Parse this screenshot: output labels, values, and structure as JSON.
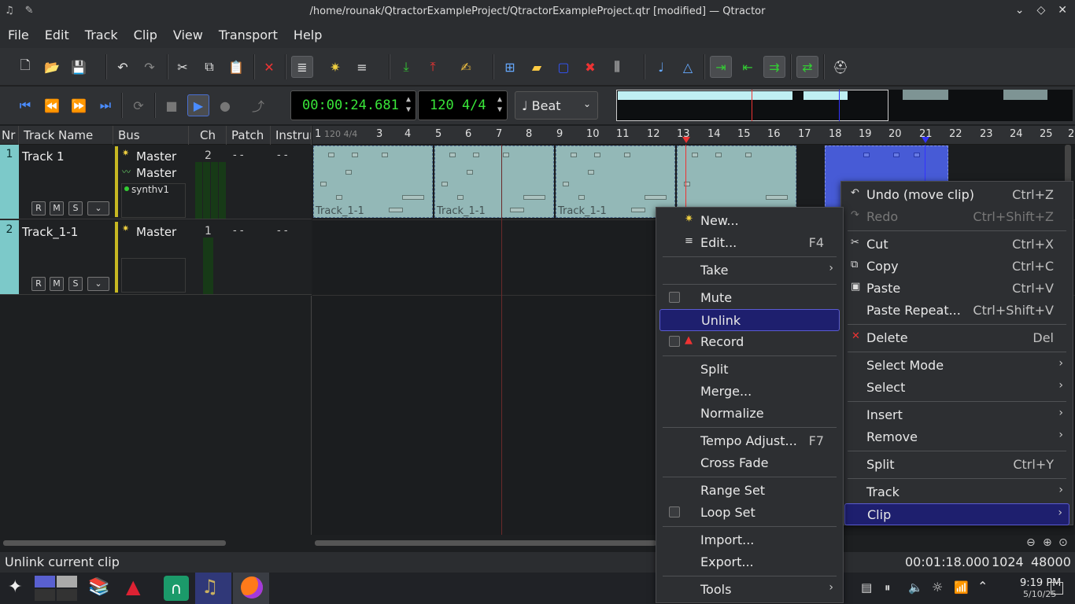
{
  "window": {
    "title": "/home/rounak/QtractorExampleProject/QtractorExampleProject.qtr [modified] — Qtractor"
  },
  "menubar": [
    "File",
    "Edit",
    "Track",
    "Clip",
    "View",
    "Transport",
    "Help"
  ],
  "transport": {
    "time": "00:00:24.681",
    "tempo": "120 4/4",
    "snap": "♩ Beat"
  },
  "track_header": {
    "col_num": "Nr",
    "col_name": "Track Name",
    "col_bus": "Bus",
    "col_ch": "Ch",
    "col_patch": "Patch",
    "col_instr": "Instrument"
  },
  "tracks": [
    {
      "num": "1",
      "name": "Track 1",
      "bus_in": "Master",
      "bus_out": "Master",
      "plugin": "synthv1",
      "ch": "2",
      "patch": "- -",
      "instr": "- -"
    },
    {
      "num": "2",
      "name": "Track_1-1",
      "bus_in": "Master",
      "ch": "1",
      "patch": "- -",
      "instr": "- -"
    }
  ],
  "rms_labels": {
    "r": "R",
    "m": "M",
    "s": "S"
  },
  "ruler": {
    "first": "1",
    "first_sig": "120 4/4",
    "bars": [
      "3",
      "4",
      "5",
      "6",
      "7",
      "8",
      "9",
      "10",
      "11",
      "12",
      "13",
      "14",
      "15",
      "16",
      "17",
      "18",
      "19",
      "20",
      "21",
      "22",
      "23",
      "24",
      "25",
      "2"
    ]
  },
  "clips": {
    "label": "Track_1-1"
  },
  "context_menu_clip": {
    "items": [
      {
        "label": "New...",
        "shortcut": ""
      },
      {
        "label": "Edit...",
        "shortcut": "F4"
      },
      {
        "label": "Take",
        "shortcut": ""
      },
      {
        "label": "Mute",
        "shortcut": ""
      },
      {
        "label": "Unlink",
        "shortcut": ""
      },
      {
        "label": "Record",
        "shortcut": ""
      },
      {
        "label": "Split",
        "shortcut": ""
      },
      {
        "label": "Merge...",
        "shortcut": ""
      },
      {
        "label": "Normalize",
        "shortcut": ""
      },
      {
        "label": "Tempo Adjust...",
        "shortcut": "F7"
      },
      {
        "label": "Cross Fade",
        "shortcut": ""
      },
      {
        "label": "Range Set",
        "shortcut": ""
      },
      {
        "label": "Loop Set",
        "shortcut": ""
      },
      {
        "label": "Import...",
        "shortcut": ""
      },
      {
        "label": "Export...",
        "shortcut": ""
      },
      {
        "label": "Tools",
        "shortcut": ""
      }
    ]
  },
  "context_menu_main": {
    "items": [
      {
        "label": "Undo (move clip)",
        "shortcut": "Ctrl+Z"
      },
      {
        "label": "Redo",
        "shortcut": "Ctrl+Shift+Z"
      },
      {
        "label": "Cut",
        "shortcut": "Ctrl+X"
      },
      {
        "label": "Copy",
        "shortcut": "Ctrl+C"
      },
      {
        "label": "Paste",
        "shortcut": "Ctrl+V"
      },
      {
        "label": "Paste Repeat...",
        "shortcut": "Ctrl+Shift+V"
      },
      {
        "label": "Delete",
        "shortcut": "Del"
      },
      {
        "label": "Select Mode",
        "shortcut": ""
      },
      {
        "label": "Select",
        "shortcut": ""
      },
      {
        "label": "Insert",
        "shortcut": ""
      },
      {
        "label": "Remove",
        "shortcut": ""
      },
      {
        "label": "Split",
        "shortcut": "Ctrl+Y"
      },
      {
        "label": "Track",
        "shortcut": ""
      },
      {
        "label": "Clip",
        "shortcut": ""
      }
    ]
  },
  "status": {
    "message": "Unlink current clip",
    "length": "00:01:18.000",
    "buffer": "1024",
    "rate": "48000"
  },
  "taskbar": {
    "time": "9:19 PM",
    "date": "5/10/25"
  },
  "colors": {
    "accent_highlight": "#1e1f6e",
    "track_color": "#7cc9c9",
    "time_display": "#39e639",
    "clip_fill": "#a8d4d2",
    "selected_clip": "#4a5fe0"
  }
}
